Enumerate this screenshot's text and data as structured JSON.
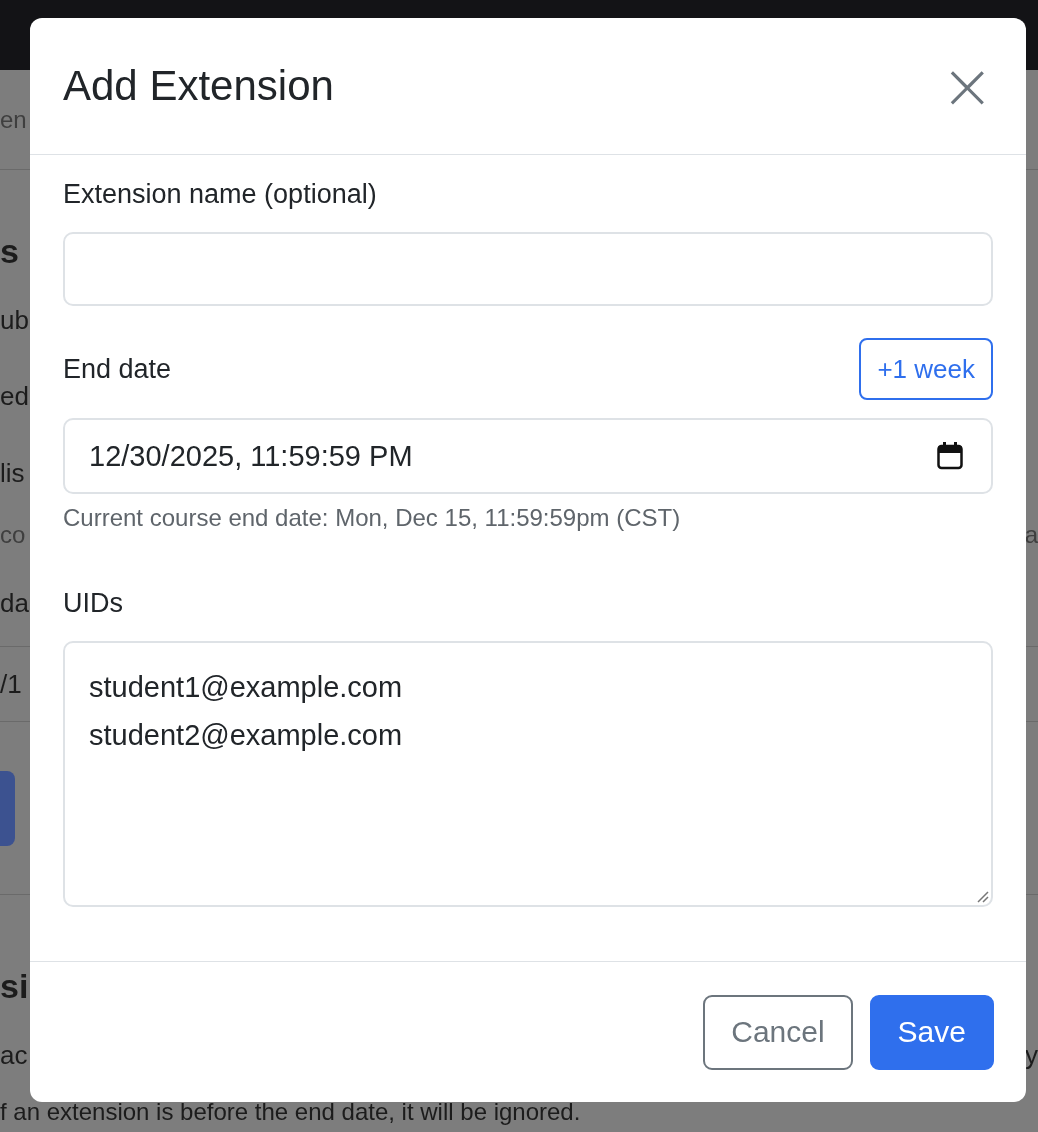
{
  "background": {
    "rows": [
      {
        "kind": "muted",
        "left": "en",
        "divider": true
      },
      {
        "kind": "heading",
        "left": "s",
        "divider": false
      },
      {
        "kind": "text",
        "left": "ub",
        "divider": false
      },
      {
        "kind": "text",
        "left": "ed",
        "divider": false
      },
      {
        "kind": "text",
        "left": "lis",
        "divider": false
      },
      {
        "kind": "muted",
        "left": "co",
        "right": "a",
        "divider": false
      },
      {
        "kind": "text",
        "left": "da",
        "divider": true
      },
      {
        "kind": "text",
        "left": "/1",
        "divider": true
      },
      {
        "kind": "button",
        "divider": true
      },
      {
        "kind": "heading",
        "left": "si",
        "divider": false
      },
      {
        "kind": "text",
        "left": "ac",
        "right": "y",
        "divider": false
      },
      {
        "kind": "text",
        "left": "f an extension is before the end date, it will be ignored.",
        "divider": false
      }
    ]
  },
  "modal": {
    "title": "Add Extension",
    "close": "×",
    "name_field": {
      "label": "Extension name (optional)"
    },
    "end_date": {
      "label": "End date",
      "button": "+1 week",
      "value": "12/30/2025, 11:59:59 PM",
      "help": "Current course end date: Mon, Dec 15, 11:59:59pm (CST)"
    },
    "uids": {
      "label": "UIDs",
      "lines": [
        "student1@example.com",
        "student2@example.com"
      ]
    },
    "buttons": [
      {
        "kind": "secondary",
        "label": "Cancel"
      },
      {
        "kind": "primary",
        "label": "Save"
      }
    ]
  }
}
